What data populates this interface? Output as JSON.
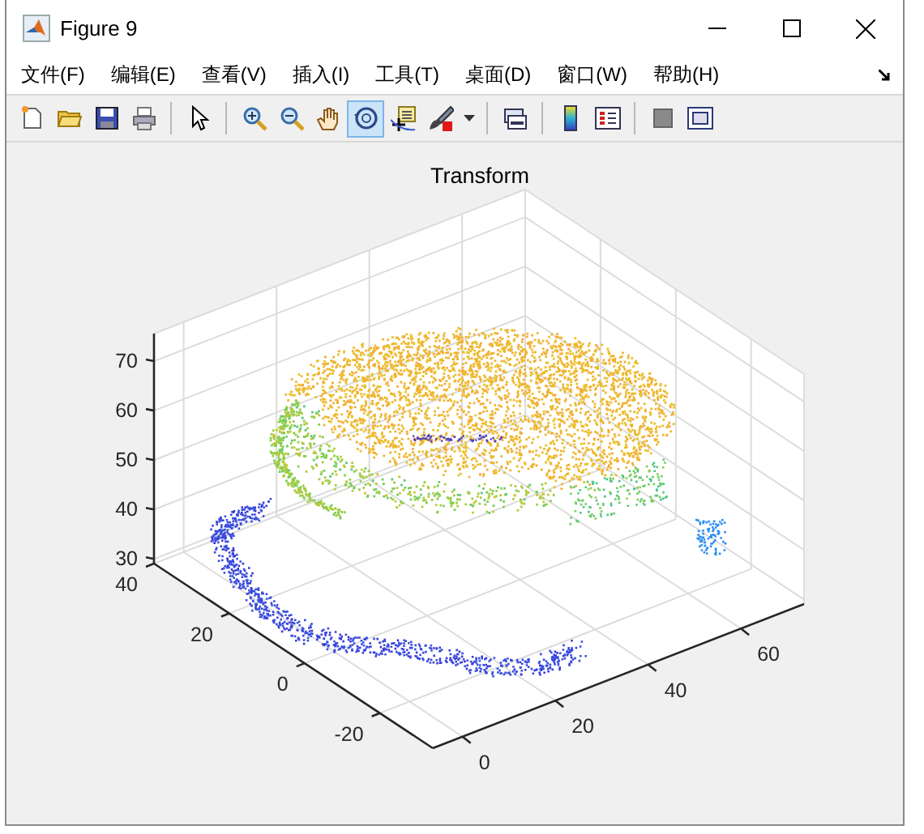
{
  "window": {
    "title": "Figure 9"
  },
  "menu": [
    {
      "label": "文件(F)"
    },
    {
      "label": "编辑(E)"
    },
    {
      "label": "查看(V)"
    },
    {
      "label": "插入(I)"
    },
    {
      "label": "工具(T)"
    },
    {
      "label": "桌面(D)"
    },
    {
      "label": "窗口(W)"
    },
    {
      "label": "帮助(H)"
    }
  ],
  "toolbar": [
    {
      "kind": "new",
      "selected": false
    },
    {
      "kind": "open",
      "selected": false
    },
    {
      "kind": "save",
      "selected": false
    },
    {
      "kind": "print",
      "selected": false
    },
    {
      "kind": "separator"
    },
    {
      "kind": "pointer",
      "selected": false
    },
    {
      "kind": "separator"
    },
    {
      "kind": "zoom-in",
      "selected": false
    },
    {
      "kind": "zoom-out",
      "selected": false
    },
    {
      "kind": "pan",
      "selected": false
    },
    {
      "kind": "rotate",
      "selected": true
    },
    {
      "kind": "datatip",
      "selected": false
    },
    {
      "kind": "brush",
      "selected": false
    },
    {
      "kind": "dropdown",
      "selected": false
    },
    {
      "kind": "separator"
    },
    {
      "kind": "link",
      "selected": false
    },
    {
      "kind": "separator"
    },
    {
      "kind": "colorbar",
      "selected": false
    },
    {
      "kind": "legend",
      "selected": false
    },
    {
      "kind": "separator"
    },
    {
      "kind": "hide",
      "selected": false
    },
    {
      "kind": "show",
      "selected": false
    }
  ],
  "plot": {
    "title": "Transform",
    "z_ticks": [
      "70",
      "60",
      "50",
      "40",
      "30"
    ],
    "y_ticks": [
      "40",
      "20",
      "0",
      "-20"
    ],
    "x_ticks": [
      "0",
      "20",
      "40",
      "60"
    ]
  }
}
